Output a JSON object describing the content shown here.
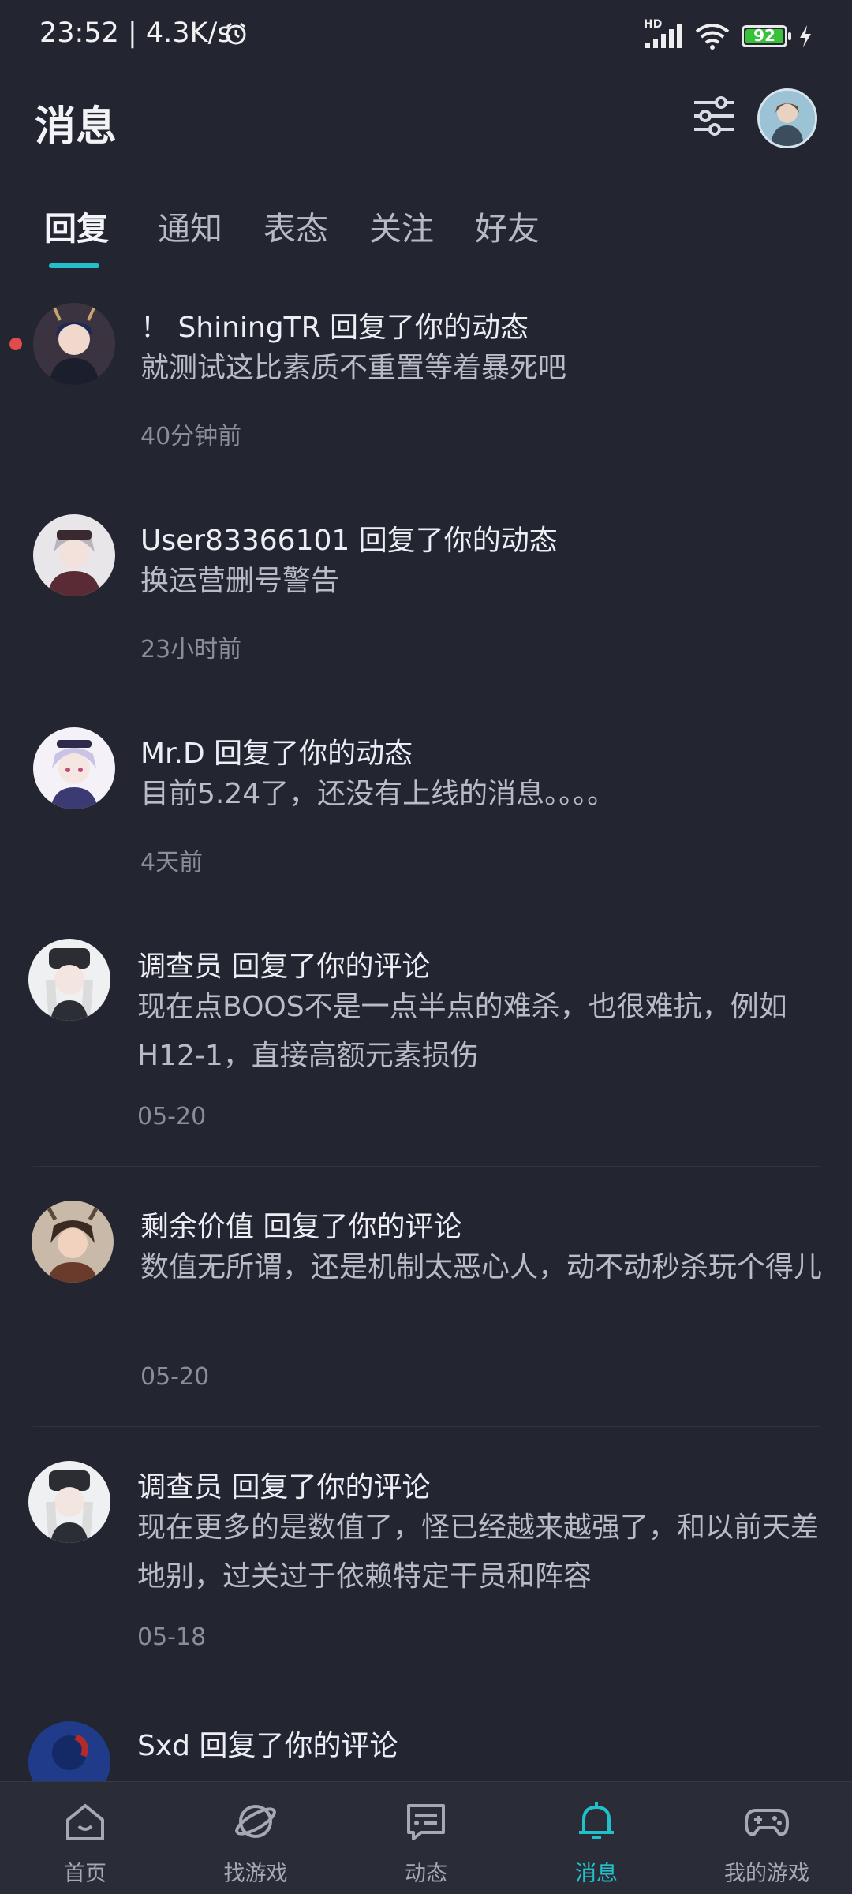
{
  "status_bar": {
    "time": "23:52 | 4.3K/s",
    "network": "HD",
    "battery": "92"
  },
  "header": {
    "title": "消息"
  },
  "tabs": [
    {
      "label": "回复",
      "active": true
    },
    {
      "label": "通知",
      "active": false
    },
    {
      "label": "表态",
      "active": false
    },
    {
      "label": "关注",
      "active": false
    },
    {
      "label": "好友",
      "active": false
    }
  ],
  "messages": [
    {
      "line": "！ ShiningTR 回复了你的动态",
      "body": "就测试这比素质不重置等着暴死吧",
      "time": "40分钟前",
      "unread": true
    },
    {
      "line": "User83366101 回复了你的动态",
      "body": "换运营删号警告",
      "time": "23小时前",
      "unread": false
    },
    {
      "line": "Mr.D 回复了你的动态",
      "body": "目前5.24了，还没有上线的消息。。。。",
      "time": "4天前",
      "unread": false
    },
    {
      "line": "调查员 回复了你的评论",
      "body": "现在点BOOS不是一点半点的难杀，也很难抗，例如H12-1，直接高额元素损伤",
      "time": "05-20",
      "unread": false
    },
    {
      "line": "剩余价值 回复了你的评论",
      "body": "数值无所谓，还是机制太恶心人，动不动秒杀玩个得儿",
      "time": "05-20",
      "unread": false
    },
    {
      "line": "调查员 回复了你的评论",
      "body": "现在更多的是数值了，怪已经越来越强了，和以前天差地别，过关过于依赖特定干员和阵容",
      "time": "05-18",
      "unread": false
    },
    {
      "line": "Sxd 回复了你的评论",
      "body": "",
      "time": "",
      "unread": false
    }
  ],
  "bottom_nav": [
    {
      "label": "首页",
      "icon": "home-icon",
      "active": false
    },
    {
      "label": "找游戏",
      "icon": "discover-icon",
      "active": false
    },
    {
      "label": "动态",
      "icon": "feed-icon",
      "active": false
    },
    {
      "label": "消息",
      "icon": "bell-icon",
      "active": true
    },
    {
      "label": "我的游戏",
      "icon": "gamepad-icon",
      "active": false
    }
  ],
  "colors": {
    "background": "#232530",
    "accent": "#22c1c9",
    "unread": "#e14b4b"
  }
}
